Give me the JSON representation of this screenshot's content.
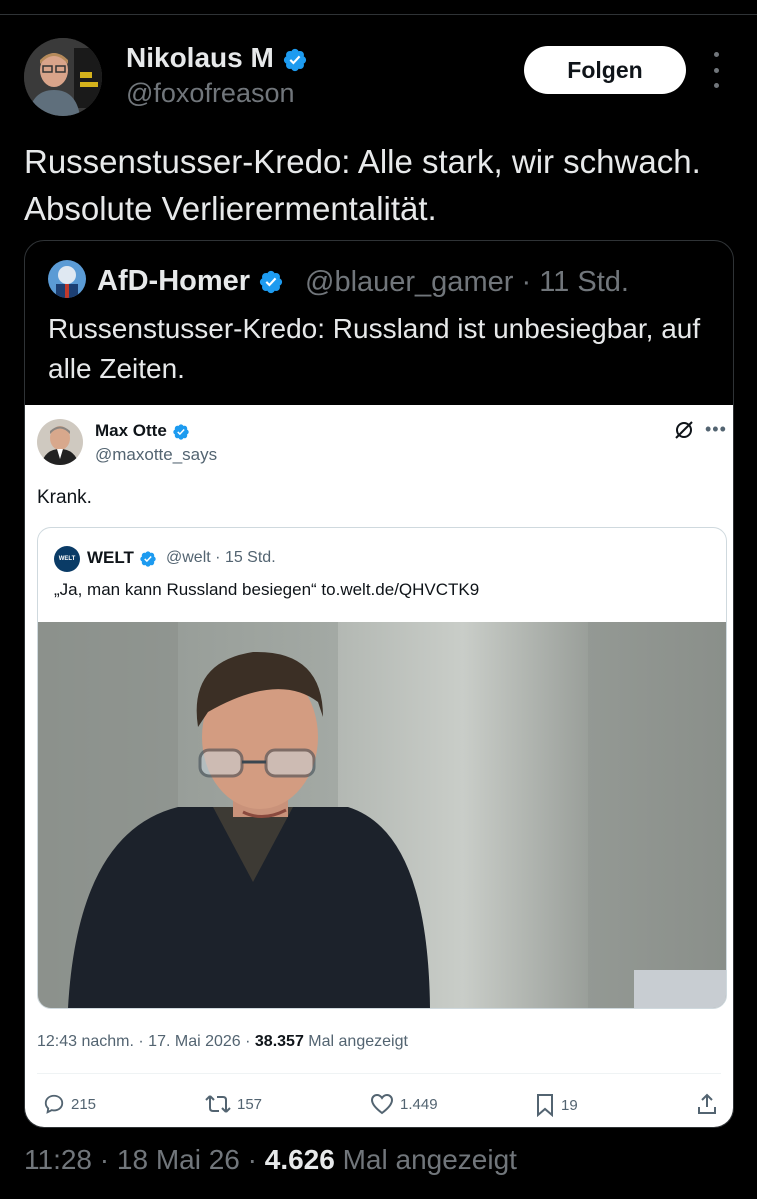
{
  "tweet": {
    "author_name": "Nikolaus M",
    "author_handle": "@foxofreason",
    "follow_label": "Folgen",
    "text": "Russenstusser-Kredo: Alle stark, wir schwach. Absolute Verlierermentalität.",
    "time": "11:28",
    "date": "18 Mai 26",
    "views": "4.626",
    "views_label": "Mal angezeigt",
    "sep": "·"
  },
  "quoted": {
    "author_name": "AfD-Homer",
    "author_handle": "@blauer_gamer",
    "age": "11 Std.",
    "text": "Russenstusser-Kredo: Russland ist unbesiegbar, auf alle Zeiten."
  },
  "screenshot": {
    "author_name": "Max Otte",
    "author_handle": "@maxotte_says",
    "text": "Krank.",
    "embedded": {
      "logo_text": "WELT",
      "author_name": "WELT",
      "author_handle": "@welt",
      "age": "15 Std.",
      "text": "„Ja, man kann Russland besiegen“ to.welt.de/QHVCTK9"
    },
    "stats": {
      "time_date": "12:43 nachm. · 17. Mai 2026 ·",
      "views": "38.357",
      "views_label": "Mal angezeigt"
    },
    "actions": {
      "replies": "215",
      "reposts": "157",
      "likes": "1.449",
      "bookmarks": "19"
    }
  },
  "colors": {
    "verified": "#1d9bf0",
    "background": "#000000",
    "secondary_text": "#71767b"
  },
  "icons": [
    "verified-badge-icon",
    "more-icon",
    "grok-icon",
    "reply-icon",
    "repost-icon",
    "like-icon",
    "bookmark-icon",
    "share-icon"
  ]
}
